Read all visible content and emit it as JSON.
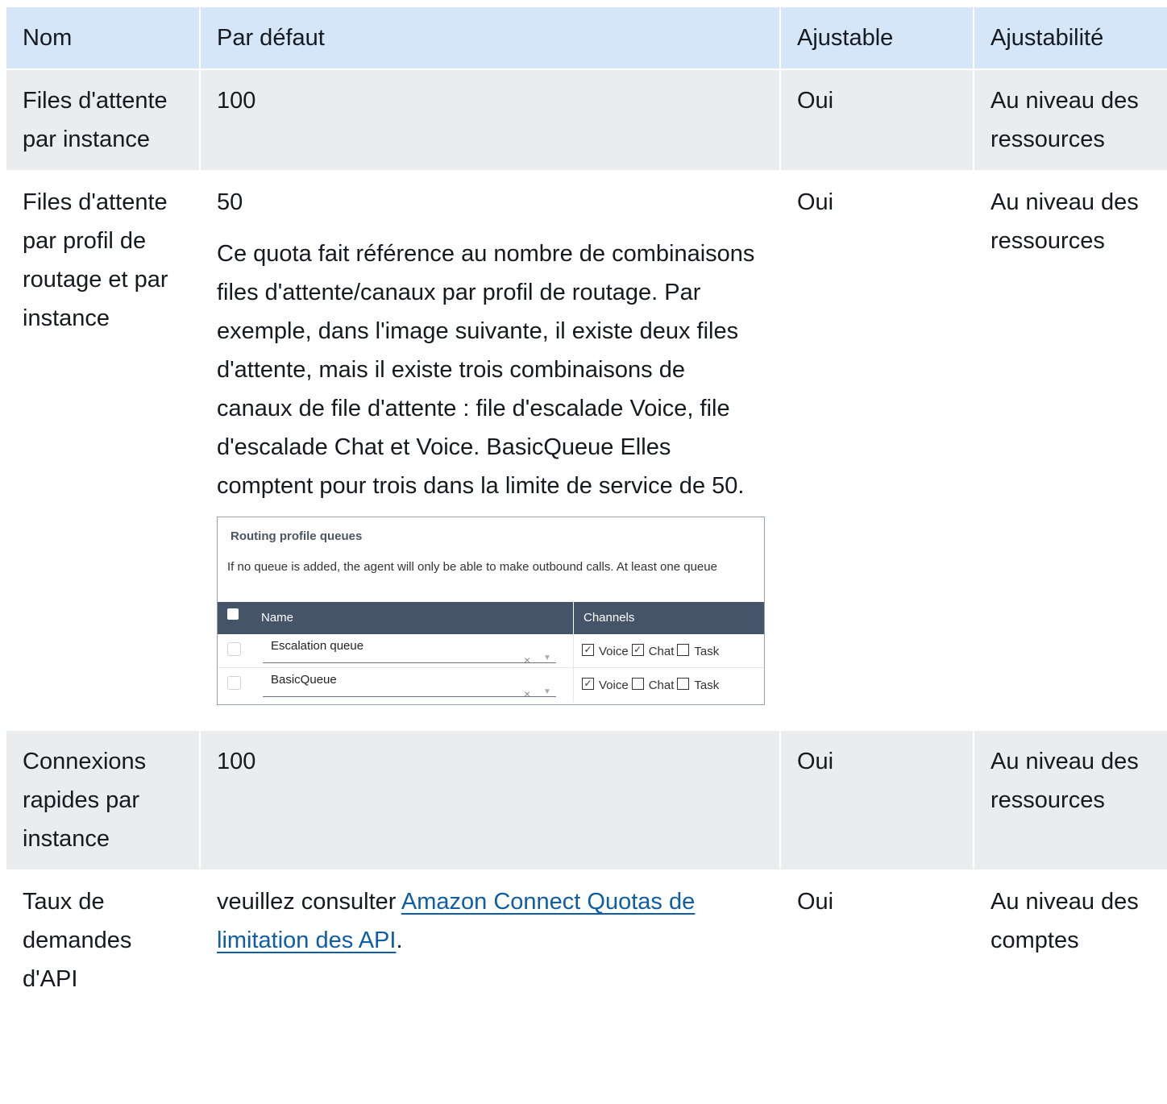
{
  "table": {
    "headers": [
      "Nom",
      "Par défaut",
      "Ajustable",
      "Ajustabilité"
    ],
    "rows": [
      {
        "name": "Files d'attente par instance",
        "default": "100",
        "adjustable": "Oui",
        "adjustability": "Au niveau des ressources"
      },
      {
        "name": "Files d'attente par profil de routage et par instance",
        "default": "50",
        "description": "Ce quota fait référence au nombre de combinaisons files d'attente/canaux par profil de routage. Par exemple, dans l'image suivante, il existe deux files d'attente, mais il existe trois combinaisons de canaux de file d'attente : file d'escalade Voice, file d'escalade Chat et Voice. BasicQueue Elles comptent pour trois dans la limite de service de 50.",
        "adjustable": "Oui",
        "adjustability": "Au niveau des ressources"
      },
      {
        "name": "Connexions rapides par instance",
        "default": "100",
        "adjustable": "Oui",
        "adjustability": "Au niveau des ressources"
      },
      {
        "name": "Taux de demandes d'API",
        "default_prefix": "veuillez consulter ",
        "default_link": "Amazon Connect Quotas de limitation des API",
        "default_suffix": ".",
        "adjustable": "Oui",
        "adjustability": "Au niveau des comptes"
      }
    ]
  },
  "screenshot": {
    "title": "Routing profile queues",
    "subtitle": "If no queue is added, the agent will only be able to make outbound calls. At least one queue",
    "col_name": "Name",
    "col_channels": "Channels",
    "queues": [
      {
        "name": "Escalation queue",
        "voice": true,
        "chat": true,
        "task": false
      },
      {
        "name": "BasicQueue",
        "voice": true,
        "chat": false,
        "task": false
      }
    ],
    "channel_labels": {
      "voice": "Voice",
      "chat": "Chat",
      "task": "Task"
    },
    "clear_glyph": "×",
    "dropdown_glyph": "▼"
  }
}
